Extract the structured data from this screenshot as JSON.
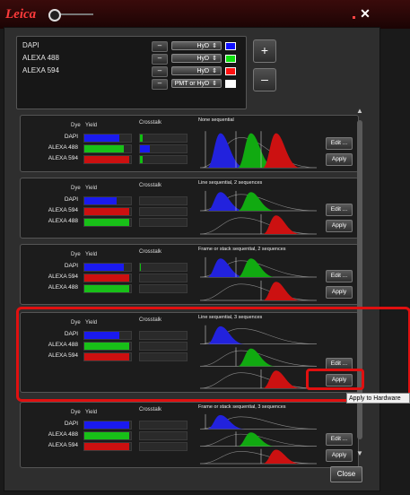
{
  "window": {
    "brand": "Leica",
    "close_glyph": "✕"
  },
  "detectors": [
    {
      "name": "DAPI",
      "detector": "HyD",
      "color": "#1010ff"
    },
    {
      "name": "ALEXA 488",
      "detector": "HyD",
      "color": "#10e010"
    },
    {
      "name": "ALEXA 594",
      "detector": "HyD",
      "color": "#ff1010"
    },
    {
      "name": "",
      "detector": "PMT or HyD",
      "color": "#ffffff"
    }
  ],
  "minus_label": "–",
  "spinner": "⇕",
  "add_button": "+",
  "remove_button": "–",
  "headers": {
    "dye": "Dye",
    "yield": "Yield",
    "crosstalk": "Crosstalk"
  },
  "edit_label": "Edit ...",
  "apply_label": "Apply",
  "panels": [
    {
      "title": "None sequential",
      "dyes": [
        {
          "name": "DAPI",
          "yield": 0.75,
          "yield_color": "#1a1aee",
          "crosstalk": 0.05,
          "crosstalk_color": "#10c010"
        },
        {
          "name": "ALEXA 488",
          "yield": 0.85,
          "yield_color": "#18c018",
          "crosstalk": 0.22,
          "crosstalk_color": "#1a1aee"
        },
        {
          "name": "ALEXA 594",
          "yield": 0.97,
          "yield_color": "#cc1010",
          "crosstalk": 0.05,
          "crosstalk_color": "#10c010"
        }
      ]
    },
    {
      "title": "Line sequential, 2 sequences",
      "dyes": [
        {
          "name": "DAPI",
          "yield": 0.7,
          "yield_color": "#1a1aee",
          "crosstalk": 0,
          "crosstalk_color": "#10c010"
        },
        {
          "name": "ALEXA 594",
          "yield": 0.97,
          "yield_color": "#cc1010",
          "crosstalk": 0,
          "crosstalk_color": "#10c010"
        },
        {
          "name": "ALEXA 488",
          "yield": 0.97,
          "yield_color": "#18c018",
          "crosstalk": 0,
          "crosstalk_color": "#10c010"
        }
      ]
    },
    {
      "title": "Frame or stack sequential, 2 sequences",
      "dyes": [
        {
          "name": "DAPI",
          "yield": 0.85,
          "yield_color": "#1a1aee",
          "crosstalk": 0.02,
          "crosstalk_color": "#10c010"
        },
        {
          "name": "ALEXA 594",
          "yield": 0.97,
          "yield_color": "#cc1010",
          "crosstalk": 0,
          "crosstalk_color": "#10c010"
        },
        {
          "name": "ALEXA 488",
          "yield": 0.97,
          "yield_color": "#18c018",
          "crosstalk": 0,
          "crosstalk_color": "#10c010"
        }
      ]
    },
    {
      "title": "Line sequential, 3 sequences",
      "dyes": [
        {
          "name": "DAPI",
          "yield": 0.75,
          "yield_color": "#1a1aee",
          "crosstalk": 0,
          "crosstalk_color": "#10c010"
        },
        {
          "name": "ALEXA 488",
          "yield": 0.97,
          "yield_color": "#18c018",
          "crosstalk": 0,
          "crosstalk_color": "#10c010"
        },
        {
          "name": "ALEXA 594",
          "yield": 0.97,
          "yield_color": "#cc1010",
          "crosstalk": 0,
          "crosstalk_color": "#10c010"
        }
      ]
    },
    {
      "title": "Frame or stack sequential, 3 sequences",
      "dyes": [
        {
          "name": "DAPI",
          "yield": 0.97,
          "yield_color": "#1a1aee",
          "crosstalk": 0,
          "crosstalk_color": "#10c010"
        },
        {
          "name": "ALEXA 488",
          "yield": 0.97,
          "yield_color": "#18c018",
          "crosstalk": 0,
          "crosstalk_color": "#10c010"
        },
        {
          "name": "ALEXA 594",
          "yield": 0.97,
          "yield_color": "#cc1010",
          "crosstalk": 0,
          "crosstalk_color": "#10c010"
        }
      ]
    }
  ],
  "tooltip": "Apply to Hardware",
  "close_label": "Close",
  "scroll_up": "▲",
  "scroll_down": "▼"
}
